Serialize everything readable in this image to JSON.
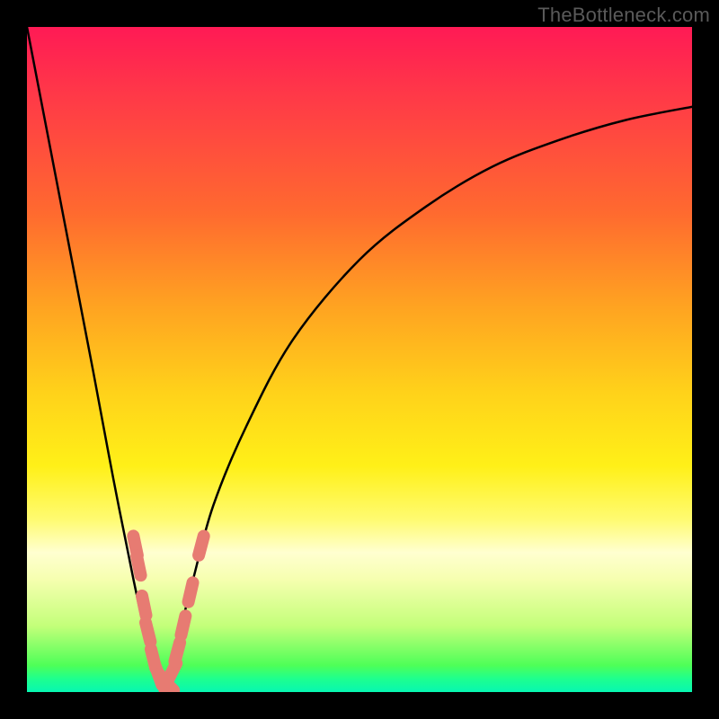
{
  "watermark": "TheBottleneck.com",
  "chart_data": {
    "type": "line",
    "title": "",
    "xlabel": "",
    "ylabel": "",
    "xlim": [
      0,
      100
    ],
    "ylim": [
      0,
      100
    ],
    "grid": false,
    "annotations": [],
    "series": [
      {
        "name": "bottleneck-curve",
        "x": [
          0,
          5,
          10,
          13,
          16,
          18,
          19.5,
          20.5,
          21,
          22,
          23,
          25,
          28,
          33,
          40,
          50,
          60,
          70,
          80,
          90,
          100
        ],
        "y": [
          100,
          74,
          48,
          32,
          17,
          8,
          3,
          1,
          1.5,
          4,
          9,
          17,
          28,
          40,
          53,
          65,
          73,
          79,
          83,
          86,
          88
        ]
      }
    ],
    "markers": [
      {
        "x": 16.3,
        "y": 22
      },
      {
        "x": 16.8,
        "y": 19
      },
      {
        "x": 17.6,
        "y": 13
      },
      {
        "x": 18.2,
        "y": 9
      },
      {
        "x": 19.0,
        "y": 5
      },
      {
        "x": 19.8,
        "y": 2.5
      },
      {
        "x": 20.4,
        "y": 1.3
      },
      {
        "x": 21.0,
        "y": 1.3
      },
      {
        "x": 21.8,
        "y": 3
      },
      {
        "x": 22.6,
        "y": 6
      },
      {
        "x": 23.5,
        "y": 10
      },
      {
        "x": 24.6,
        "y": 15
      },
      {
        "x": 26.2,
        "y": 22
      }
    ],
    "background_gradient": {
      "top": "#ff1a55",
      "mid": "#fff018",
      "bottom": "#07f7b2"
    }
  }
}
